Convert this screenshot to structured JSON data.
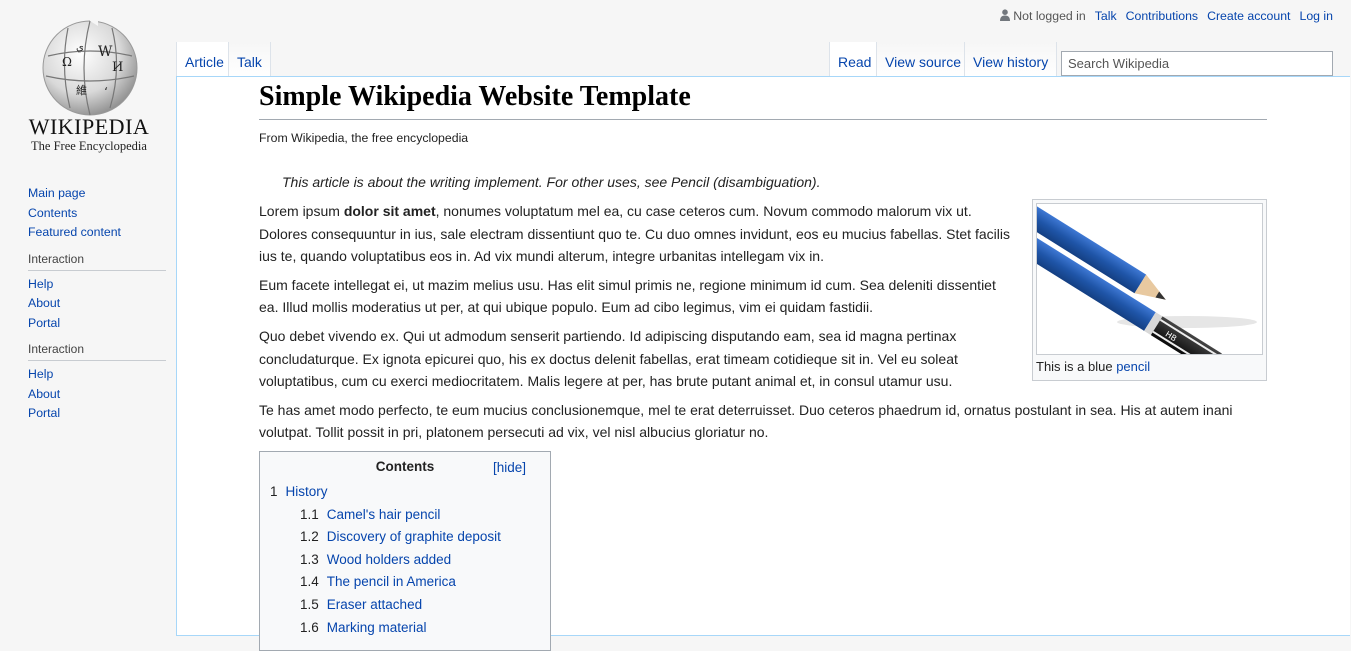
{
  "logo": {
    "wordmark": "WIKIPEDIA",
    "tagline": "The Free Encyclopedia",
    "icon": "wikipedia-globe-icon"
  },
  "sidebar": {
    "main_items": [
      {
        "label": "Main page"
      },
      {
        "label": "Contents"
      },
      {
        "label": "Featured content"
      }
    ],
    "portals": [
      {
        "heading": "Interaction",
        "items": [
          {
            "label": "Help"
          },
          {
            "label": "About"
          },
          {
            "label": "Portal"
          }
        ]
      },
      {
        "heading": "Interaction",
        "items": [
          {
            "label": "Help"
          },
          {
            "label": "About"
          },
          {
            "label": "Portal"
          }
        ]
      }
    ]
  },
  "personal": {
    "not_logged_in": "Not logged in",
    "talk": "Talk",
    "contributions": "Contributions",
    "create_account": "Create account",
    "log_in": "Log in",
    "icon": "user-icon"
  },
  "tabs": {
    "article": "Article",
    "talk": "Talk",
    "read": "Read",
    "view_source": "View source",
    "view_history": "View history"
  },
  "search": {
    "placeholder": "Search Wikipedia"
  },
  "article": {
    "title": "Simple Wikipedia Website Template",
    "site_sub": "From Wikipedia, the free encyclopedia",
    "hatnote": "This article is about the writing implement. For other uses, see Pencil (disambiguation).",
    "p1_before": "Lorem ipsum ",
    "p1_bold": "dolor sit amet",
    "p1_after": ", nonumes voluptatum mel ea, cu case ceteros cum. Novum commodo malorum vix ut. Dolores consequuntur in ius, sale electram dissentiunt quo te. Cu duo omnes invidunt, eos eu mucius fabellas. Stet facilis ius te, quando voluptatibus eos in. Ad vix mundi alterum, integre urbanitas intellegam vix in.",
    "p2": "Eum facete intellegat ei, ut mazim melius usu. Has elit simul primis ne, regione minimum id cum. Sea deleniti dissentiet ea. Illud mollis moderatius ut per, at qui ubique populo. Eum ad cibo legimus, vim ei quidam fastidii.",
    "p3": "Quo debet vivendo ex. Qui ut admodum senserit partiendo. Id adipiscing disputando eam, sea id magna pertinax concludaturque. Ex ignota epicurei quo, his ex doctus delenit fabellas, erat timeam cotidieque sit in. Vel eu soleat voluptatibus, cum cu exerci mediocritatem. Malis legere at per, has brute putant animal et, in consul utamur usu.",
    "p4": "Te has amet modo perfecto, te eum mucius conclusionemque, mel te erat deterruisset. Duo ceteros phaedrum id, ornatus postulant in sea. His at autem inani volutpat. Tollit possit in pri, platonem persecuti ad vix, vel nisl albucius gloriatur no."
  },
  "thumbnail": {
    "caption_text": "This is a blue ",
    "caption_link": "pencil",
    "pencil_label": "HB",
    "image": "blue-pencil-image",
    "colors": {
      "pencil_blue": "#1f55a8",
      "cap_black": "#111111"
    }
  },
  "toc": {
    "title": "Contents",
    "toggle": "[hide]",
    "items": [
      {
        "num": "1",
        "label": "History"
      }
    ],
    "subitems": [
      {
        "num": "1.1",
        "label": "Camel's hair pencil"
      },
      {
        "num": "1.2",
        "label": "Discovery of graphite deposit"
      },
      {
        "num": "1.3",
        "label": "Wood holders added"
      },
      {
        "num": "1.4",
        "label": "The pencil in America"
      },
      {
        "num": "1.5",
        "label": "Eraser attached"
      },
      {
        "num": "1.6",
        "label": "Marking material"
      }
    ]
  },
  "colors": {
    "link": "#0645ad",
    "content_border": "#a7d7f9",
    "page_bg": "#f6f6f6"
  }
}
